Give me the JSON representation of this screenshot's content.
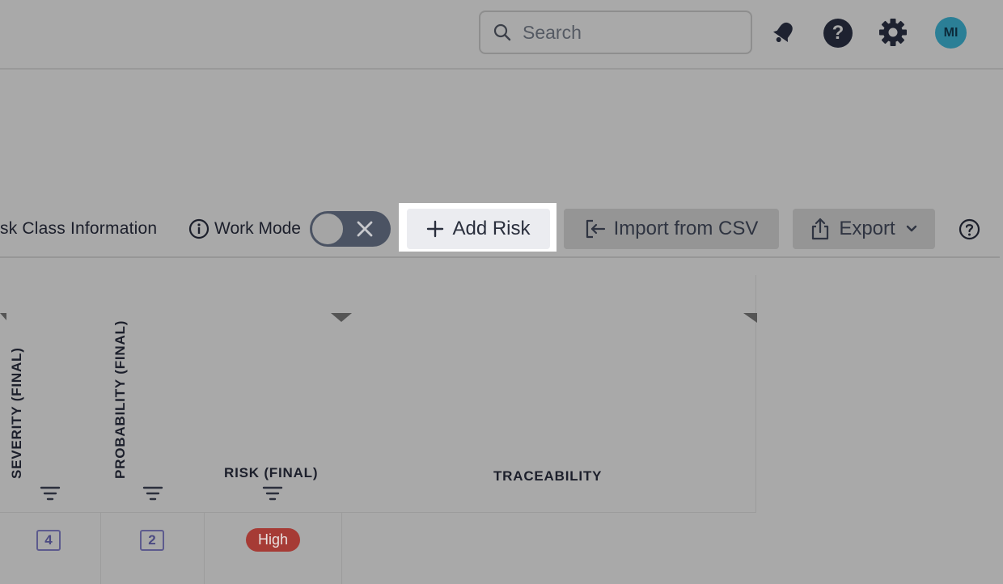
{
  "header": {
    "search_placeholder": "Search",
    "icons": [
      "bell-icon",
      "help-circle-icon",
      "gear-icon"
    ],
    "avatar_initials": "MI"
  },
  "toolbar": {
    "risk_class_label": "sk Class Information",
    "work_mode_label": "Work Mode",
    "work_mode_on": false,
    "add_risk_label": "Add Risk",
    "import_label": "Import from CSV",
    "export_label": "Export"
  },
  "table": {
    "columns": [
      "SEVERITY (FINAL)",
      "PROBABILITY (FINAL)",
      "RISK (FINAL)",
      "TRACEABILITY"
    ],
    "rows": [
      {
        "severity": "4",
        "probability": "2",
        "risk": "High",
        "traceability": ""
      }
    ]
  },
  "colors": {
    "background": "#a9a9a9",
    "toggle_track": "#4b5363",
    "add_risk_bg": "#ebecf0",
    "risk_high": "#a63b35",
    "avatar": "#2b7f96",
    "badge_border": "#5d5b8e"
  }
}
